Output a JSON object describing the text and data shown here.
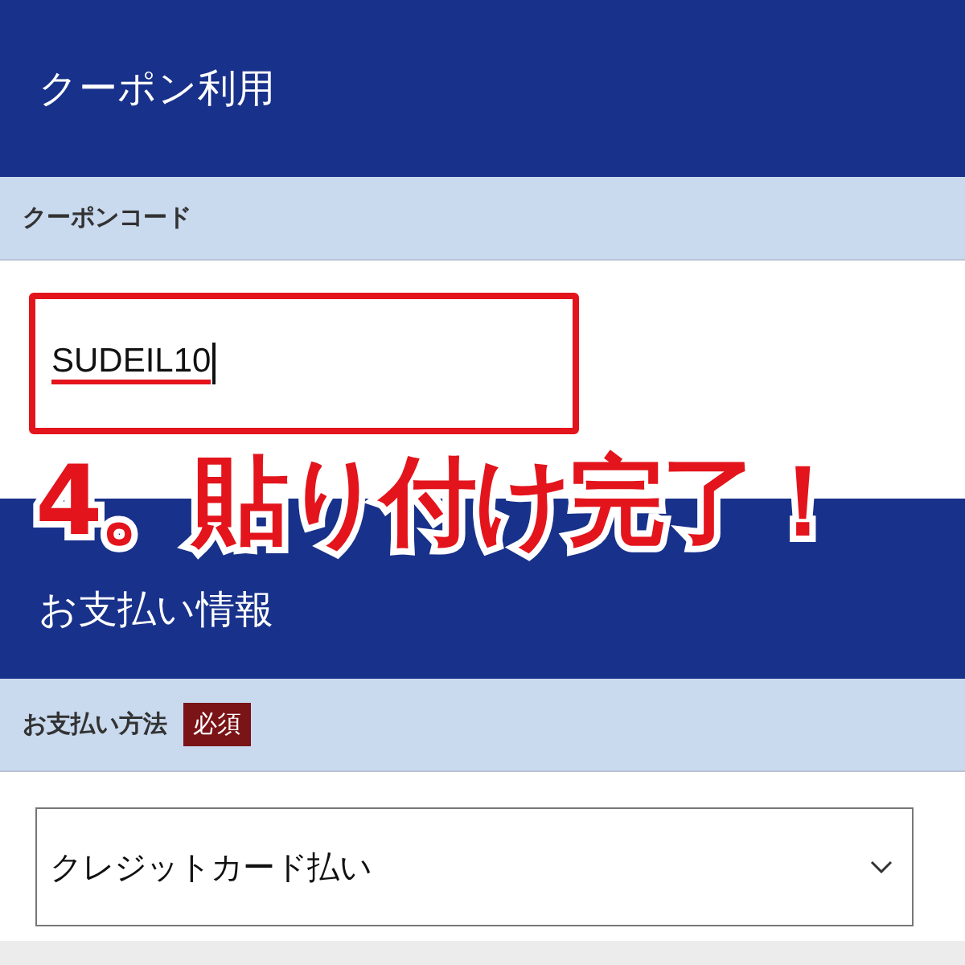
{
  "coupon_header": {
    "title": "クーポン利用"
  },
  "coupon_code": {
    "label": "クーポンコード",
    "value": "SUDEIL10"
  },
  "annotation": {
    "text": "4。貼り付け完了！"
  },
  "payment_header": {
    "title": "お支払い情報"
  },
  "payment_method": {
    "label": "お支払い方法",
    "badge": "必須",
    "value": "クレジットカード払い"
  }
}
